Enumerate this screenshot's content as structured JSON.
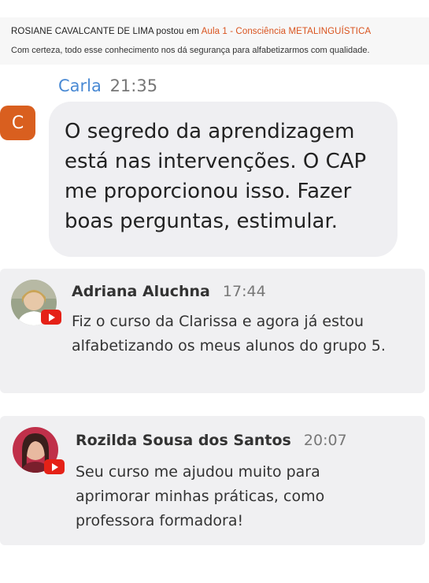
{
  "post": {
    "author": "ROSIANE CAVALCANTE DE LIMA",
    "verb": "postou em",
    "course": "Aula 1 - Consciência METALINGUÍSTICA",
    "text": "Com certeza, todo esse conhecimento nos dá segurança para alfabetizarmos com qualidade."
  },
  "carla": {
    "name": "Carla",
    "time": "21:35",
    "initial": "C",
    "message": "O segredo da aprendizagem está nas intervenções. O CAP me proporcionou isso. Fazer boas perguntas, estimular."
  },
  "comments": [
    {
      "name": "Adriana Aluchna",
      "time": "17:44",
      "text": "Fiz o curso da Clarissa e agora já estou alfabetizando os meus alunos do grupo 5."
    },
    {
      "name": "Rozilda Sousa dos Santos",
      "time": "20:07",
      "text": "Seu curso me ajudou muito para aprimorar minhas práticas, como professora formadora!"
    }
  ],
  "colors": {
    "accent_orange": "#d9531e",
    "name_blue": "#4a8ad4",
    "youtube_red": "#e52117"
  },
  "icons": [
    "youtube-icon"
  ]
}
